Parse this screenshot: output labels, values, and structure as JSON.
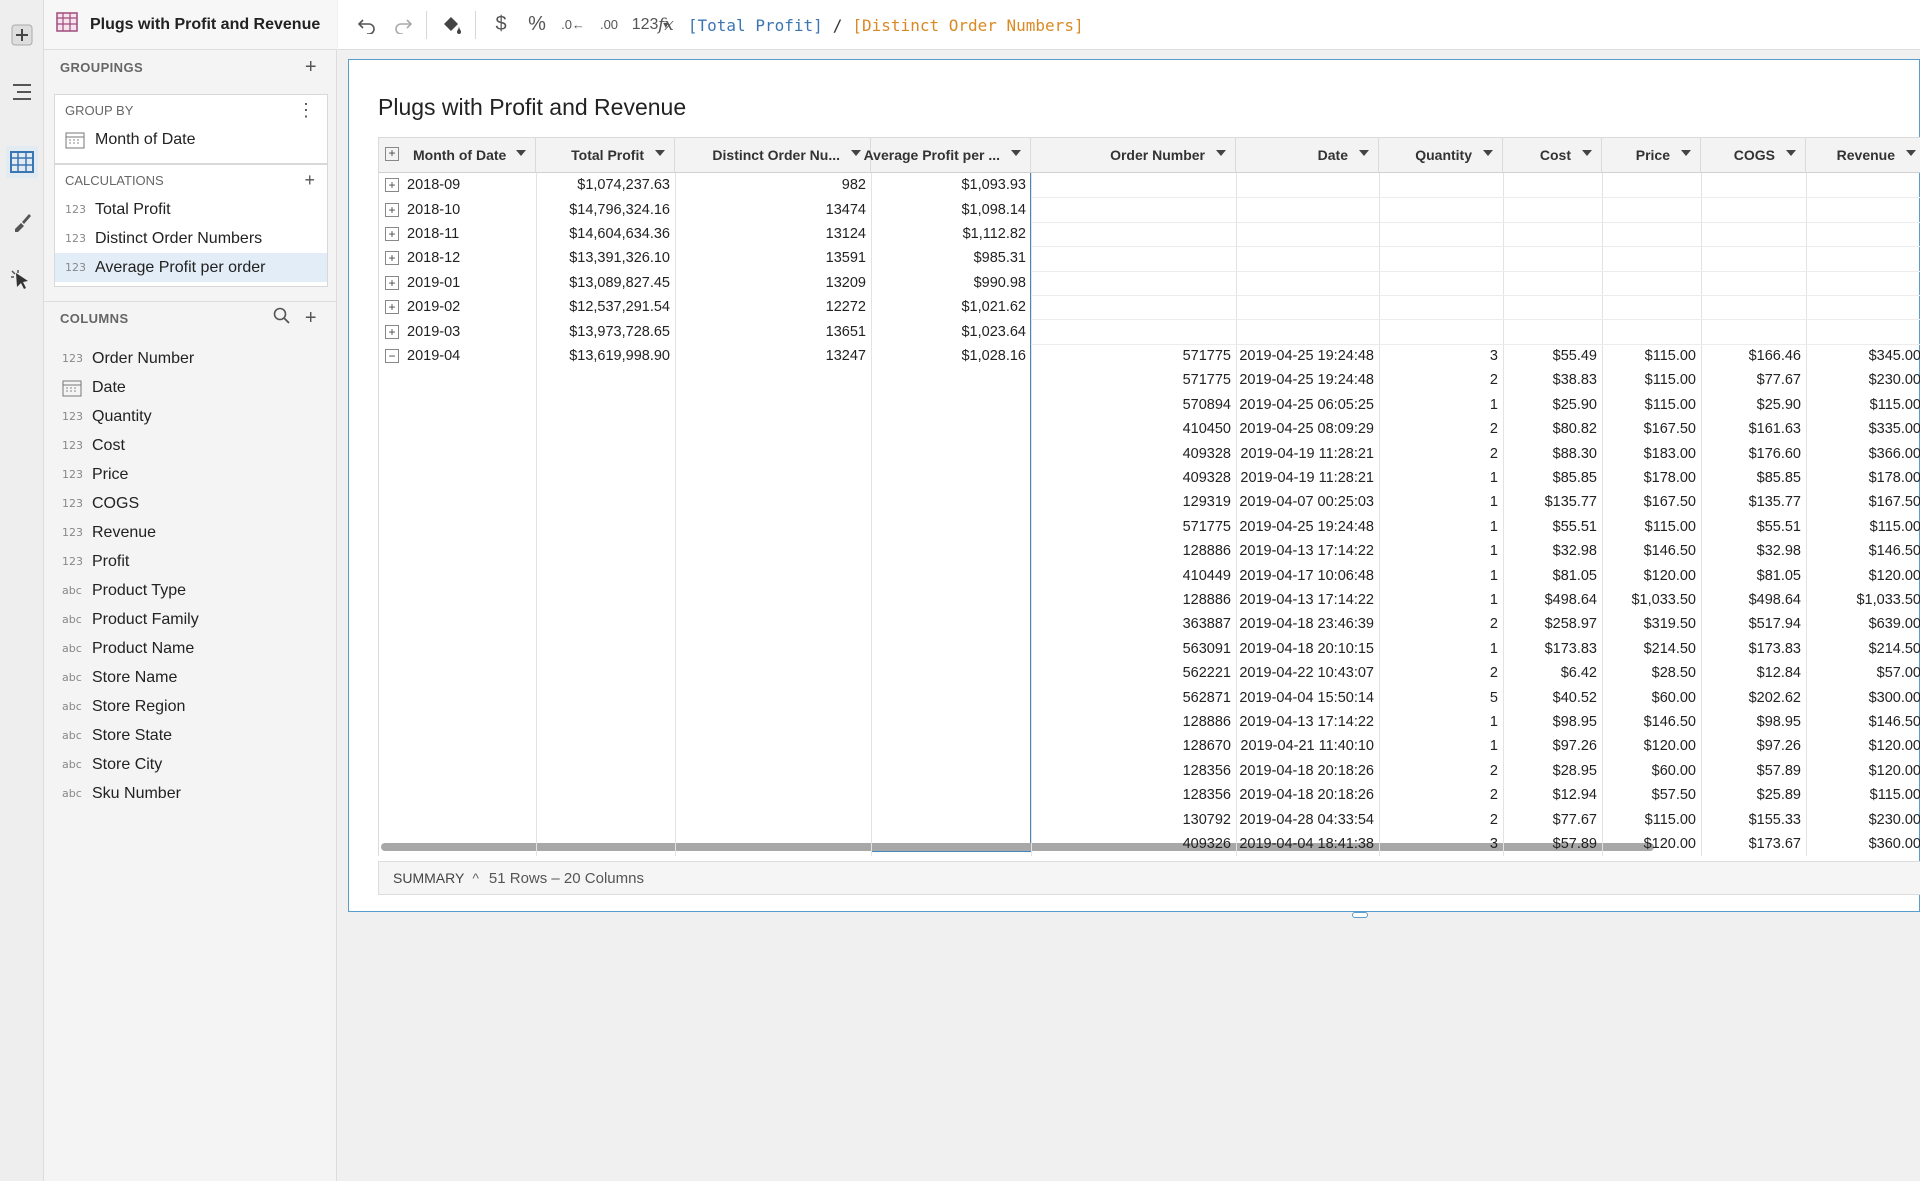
{
  "workbook": {
    "title": "Plugs with Profit and Revenue"
  },
  "sidebar": {
    "groupings_label": "GROUPINGS",
    "group_by_label": "GROUP BY",
    "group_by_value": "Month of Date",
    "calculations_label": "CALCULATIONS",
    "calculations": [
      "Total Profit",
      "Distinct Order Numbers",
      "Average Profit per order"
    ],
    "columns_label": "COLUMNS",
    "columns": [
      {
        "type": "123",
        "label": "Order Number"
      },
      {
        "type": "date",
        "label": "Date"
      },
      {
        "type": "123",
        "label": "Quantity"
      },
      {
        "type": "123",
        "label": "Cost"
      },
      {
        "type": "123",
        "label": "Price"
      },
      {
        "type": "123",
        "label": "COGS"
      },
      {
        "type": "123",
        "label": "Revenue"
      },
      {
        "type": "123",
        "label": "Profit"
      },
      {
        "type": "abc",
        "label": "Product Type"
      },
      {
        "type": "abc",
        "label": "Product Family"
      },
      {
        "type": "abc",
        "label": "Product Name"
      },
      {
        "type": "abc",
        "label": "Store Name"
      },
      {
        "type": "abc",
        "label": "Store Region"
      },
      {
        "type": "abc",
        "label": "Store State"
      },
      {
        "type": "abc",
        "label": "Store City"
      },
      {
        "type": "abc",
        "label": "Sku Number"
      }
    ],
    "type_labels": {
      "num": "123",
      "abc": "abc"
    }
  },
  "toolbar": {
    "number_format_label": "123",
    "formula": {
      "ref1": "[Total Profit]",
      "op": "/",
      "ref2": "[Distinct Order Numbers]"
    }
  },
  "table": {
    "title": "Plugs with Profit and Revenue",
    "headers": [
      "Month of Date",
      "Total Profit",
      "Distinct Order Nu...",
      "Average Profit per ...",
      "Order Number",
      "Date",
      "Quantity",
      "Cost",
      "Price",
      "COGS",
      "Revenue"
    ],
    "groups": [
      {
        "month": "2018-09",
        "total_profit": "$1,074,237.63",
        "distinct": "982",
        "avg": "$1,093.93",
        "expanded": false
      },
      {
        "month": "2018-10",
        "total_profit": "$14,796,324.16",
        "distinct": "13474",
        "avg": "$1,098.14",
        "expanded": false
      },
      {
        "month": "2018-11",
        "total_profit": "$14,604,634.36",
        "distinct": "13124",
        "avg": "$1,112.82",
        "expanded": false
      },
      {
        "month": "2018-12",
        "total_profit": "$13,391,326.10",
        "distinct": "13591",
        "avg": "$985.31",
        "expanded": false
      },
      {
        "month": "2019-01",
        "total_profit": "$13,089,827.45",
        "distinct": "13209",
        "avg": "$990.98",
        "expanded": false
      },
      {
        "month": "2019-02",
        "total_profit": "$12,537,291.54",
        "distinct": "12272",
        "avg": "$1,021.62",
        "expanded": false
      },
      {
        "month": "2019-03",
        "total_profit": "$13,973,728.65",
        "distinct": "13651",
        "avg": "$1,023.64",
        "expanded": false
      },
      {
        "month": "2019-04",
        "total_profit": "$13,619,998.90",
        "distinct": "13247",
        "avg": "$1,028.16",
        "expanded": true
      }
    ],
    "detail_rows": [
      [
        "571775",
        "2019-04-25 19:24:48",
        "3",
        "$55.49",
        "$115.00",
        "$166.46",
        "$345.00"
      ],
      [
        "571775",
        "2019-04-25 19:24:48",
        "2",
        "$38.83",
        "$115.00",
        "$77.67",
        "$230.00"
      ],
      [
        "570894",
        "2019-04-25 06:05:25",
        "1",
        "$25.90",
        "$115.00",
        "$25.90",
        "$115.00"
      ],
      [
        "410450",
        "2019-04-25 08:09:29",
        "2",
        "$80.82",
        "$167.50",
        "$161.63",
        "$335.00"
      ],
      [
        "409328",
        "2019-04-19 11:28:21",
        "2",
        "$88.30",
        "$183.00",
        "$176.60",
        "$366.00"
      ],
      [
        "409328",
        "2019-04-19 11:28:21",
        "1",
        "$85.85",
        "$178.00",
        "$85.85",
        "$178.00"
      ],
      [
        "129319",
        "2019-04-07 00:25:03",
        "1",
        "$135.77",
        "$167.50",
        "$135.77",
        "$167.50"
      ],
      [
        "571775",
        "2019-04-25 19:24:48",
        "1",
        "$55.51",
        "$115.00",
        "$55.51",
        "$115.00"
      ],
      [
        "128886",
        "2019-04-13 17:14:22",
        "1",
        "$32.98",
        "$146.50",
        "$32.98",
        "$146.50"
      ],
      [
        "410449",
        "2019-04-17 10:06:48",
        "1",
        "$81.05",
        "$120.00",
        "$81.05",
        "$120.00"
      ],
      [
        "128886",
        "2019-04-13 17:14:22",
        "1",
        "$498.64",
        "$1,033.50",
        "$498.64",
        "$1,033.50"
      ],
      [
        "363887",
        "2019-04-18 23:46:39",
        "2",
        "$258.97",
        "$319.50",
        "$517.94",
        "$639.00"
      ],
      [
        "563091",
        "2019-04-18 20:10:15",
        "1",
        "$173.83",
        "$214.50",
        "$173.83",
        "$214.50"
      ],
      [
        "562221",
        "2019-04-22 10:43:07",
        "2",
        "$6.42",
        "$28.50",
        "$12.84",
        "$57.00"
      ],
      [
        "562871",
        "2019-04-04 15:50:14",
        "5",
        "$40.52",
        "$60.00",
        "$202.62",
        "$300.00"
      ],
      [
        "128886",
        "2019-04-13 17:14:22",
        "1",
        "$98.95",
        "$146.50",
        "$98.95",
        "$146.50"
      ],
      [
        "128670",
        "2019-04-21 11:40:10",
        "1",
        "$97.26",
        "$120.00",
        "$97.26",
        "$120.00"
      ],
      [
        "128356",
        "2019-04-18 20:18:26",
        "2",
        "$28.95",
        "$60.00",
        "$57.89",
        "$120.00"
      ],
      [
        "128356",
        "2019-04-18 20:18:26",
        "2",
        "$12.94",
        "$57.50",
        "$25.89",
        "$115.00"
      ],
      [
        "130792",
        "2019-04-28 04:33:54",
        "2",
        "$77.67",
        "$115.00",
        "$155.33",
        "$230.00"
      ],
      [
        "409326",
        "2019-04-04 18:41:38",
        "3",
        "$57.89",
        "$120.00",
        "$173.67",
        "$360.00"
      ]
    ]
  },
  "summary": {
    "label": "SUMMARY",
    "count": "51 Rows – 20 Columns"
  },
  "colors": {
    "accent": "#4a86b8",
    "formula_ref1": "#3b76b3",
    "formula_ref2": "#d98a24",
    "selected_row": "#e3edf7"
  }
}
